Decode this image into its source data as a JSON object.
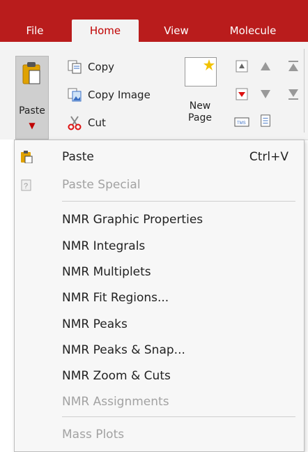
{
  "tabs": [
    {
      "label": "File",
      "active": false
    },
    {
      "label": "Home",
      "active": true
    },
    {
      "label": "View",
      "active": false
    },
    {
      "label": "Molecule",
      "active": false
    }
  ],
  "ribbon": {
    "paste_label": "Paste",
    "copy_label": "Copy",
    "copy_image_label": "Copy Image",
    "cut_label": "Cut",
    "new_page_line1": "New",
    "new_page_line2": "Page"
  },
  "menu": {
    "paste": {
      "label": "Paste",
      "shortcut": "Ctrl+V"
    },
    "paste_special": {
      "label": "Paste Special"
    },
    "items": [
      "NMR Graphic Properties",
      "NMR Integrals",
      "NMR Multiplets",
      "NMR Fit Regions...",
      "NMR Peaks",
      "NMR Peaks & Snap...",
      "NMR Zoom & Cuts",
      "NMR Assignments"
    ],
    "mass_plots": "Mass Plots"
  },
  "colors": {
    "tabbar": "#b91c1c",
    "active_tab_text": "#c00000",
    "disabled_text": "#a2a2a2"
  }
}
